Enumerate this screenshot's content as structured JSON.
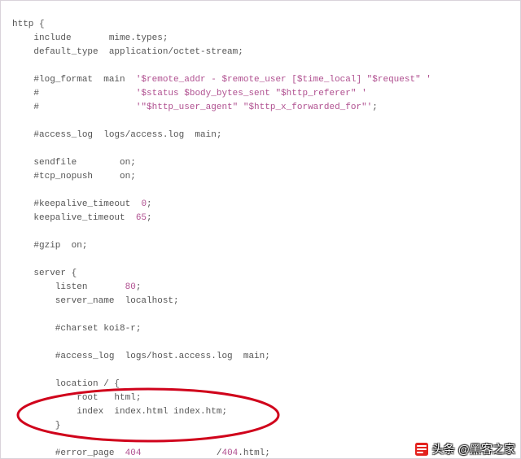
{
  "code": {
    "l01": "http {",
    "l02": "    include       mime.types;",
    "l03": "    default_type  application/octet-stream;",
    "l04": "",
    "l05a": "    #log_format  main  ",
    "l05b": "'$remote_addr - $remote_user [$time_local] \"$request\" '",
    "l06a": "    #                  ",
    "l06b": "'$status $body_bytes_sent \"$http_referer\" '",
    "l07a": "    #                  ",
    "l07b": "'\"$http_user_agent\" \"$http_x_forwarded_for\"'",
    "l07c": ";",
    "l08": "",
    "l09": "    #access_log  logs/access.log  main;",
    "l10": "",
    "l11": "    sendfile        on;",
    "l12": "    #tcp_nopush     on;",
    "l13": "",
    "l14a": "    #keepalive_timeout  ",
    "l14b": "0",
    "l14c": ";",
    "l15a": "    keepalive_timeout  ",
    "l15b": "65",
    "l15c": ";",
    "l16": "",
    "l17": "    #gzip  on;",
    "l18": "",
    "l19": "    server {",
    "l20a": "        listen       ",
    "l20b": "80",
    "l20c": ";",
    "l21": "        server_name  localhost;",
    "l22": "",
    "l23": "        #charset koi8-r;",
    "l24": "",
    "l25": "        #access_log  logs/host.access.log  main;",
    "l26": "",
    "l27": "        location / {",
    "l28": "            root   html;",
    "l29": "            index  index.html index.htm;",
    "l30": "        }",
    "l31": "",
    "l32a": "        #error_page  ",
    "l32b": "404",
    "l32c": "              /",
    "l32d": "404",
    "l32e": ".html;"
  },
  "watermark": {
    "prefix": "头条",
    "handle": "@黑客之家"
  }
}
